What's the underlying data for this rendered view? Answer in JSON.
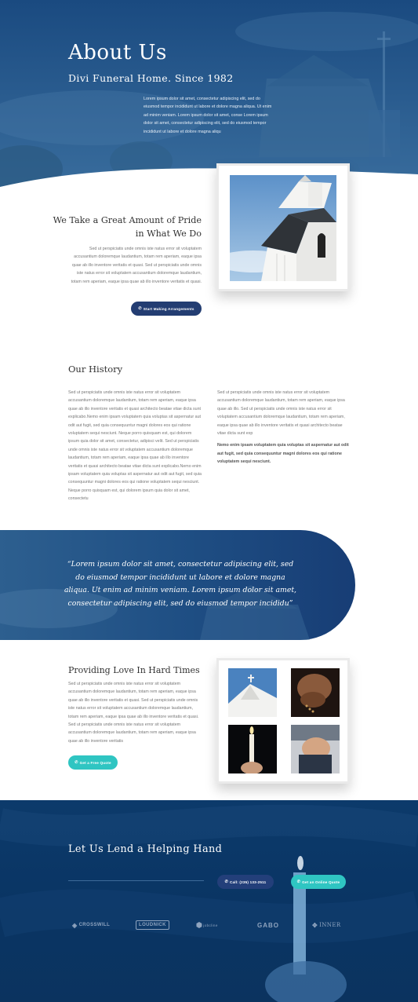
{
  "hero": {
    "title": "About Us",
    "subtitle": "Divi Funeral Home. Since 1982",
    "text": "Lorem ipsum dolor sit amet, consectetur adipiscing elit, sed do eiusmod tempor incididunt ut labore et dolore magna aliqua. Ut enim ad minim veniam. Lorem ipsum dolor sit amet, conse Lorem ipsum dolor sit amet, consectetur adipiscing elit, sed do eiusmod tempor incididunt ut labore et dolore magna aliqu"
  },
  "intro": {
    "title": "We Take a Great Amount of Pride in What We Do",
    "text": "Sed ut perspiciatis unde omnis iste natus error sit voluptatem accusantium doloremque laudantium, totam rem aperiam, eaque ipsa quae ab illo inventore veritatis et quasi. Sed ut perspiciatis unde omnis iste natus error sit voluptatem accusantium doloremque laudantium, totam rem aperiam, eaque ipsa quae ab illo inventore veritatis et quasi.",
    "button_label": "Start Making Arrangements",
    "button_icon": "phone-icon"
  },
  "history": {
    "title": "Our History",
    "left_text": "Sed ut perspiciatis unde omnis iste natus error sit voluptatem accusantium doloremque laudantium, totam rem aperiam, eaque ipsa quae ab illo inventore veritatis et quasi architecto beatae vitae dicta sunt explicabo.Nemo enim ipsam voluptatem quia voluptas sit aspernatur aut odit aut fugit, sed quia consequuntur magni dolores eos qui ratione voluptatem sequi nesciunt. Neque porro quisquam est, qui dolorem ipsum quia dolor sit amet, consectetur, adipisci velit. Sed ut perspiciatis unde omnis iste natus error sit voluptatem accusantium doloremque laudantium, totam rem aperiam, eaque ipsa quae ab illo inventore veritatis et quasi architecto beatae vitae dicta sunt explicabo.Nemo enim ipsam voluptatem quia voluptas sit aspernatur aut odit aut fugit, sed quia consequuntur magni dolores eos qui ratione voluptatem sequi nesciunt. Neque porro quisquam est, qui dolorem ipsum quia dolor sit amet, consectetu",
    "right_text": "Sed ut perspiciatis unde omnis iste natus error sit voluptatem accusantium doloremque laudantium, totam rem aperiam, eaque ipsa quae ab illo. Sed ut perspiciatis unde omnis iste natus error sit voluptatem accusantium doloremque laudantium, totam rem aperiam, eaque ipsa quae ab illo inventore veritatis et quasi architecto beatae vitae dicta sunt exp",
    "right_bold": "Nemo enim ipsam voluptatem quia voluptas sit aspernatur aut odit aut fugit, sed quia consequuntur magni dolores eos qui ratione voluptatem sequi nesciunt."
  },
  "quote": {
    "text": "“Lorem ipsum dolor sit amet, consectetur adipiscing elit, sed do eiusmod tempor incididunt ut labore et dolore magna aliqua. Ut enim ad minim veniam. Lorem ipsum dolor sit amet, consectetur adipiscing elit, sed do eiusmod tempor incididu”"
  },
  "love": {
    "title": "Providing Love In Hard Times",
    "text": "Sed ut perspiciatis unde omnis iste natus error sit voluptatem accusantium doloremque laudantium, totam rem aperiam, eaque ipsa quae ab illo inventore veritatis et quasi. Sed ut perspiciatis unde omnis iste natus error sit voluptatem accusantium doloremque laudantium, totam rem aperiam, eaque ipsa quae ab illo inventore veritatis et quasi. Sed ut perspiciatis unde omnis iste natus error sit voluptatem accusantium doloremque laudantium, totam rem aperiam, eaque ipsa quae ab illo inventore veritatis",
    "button_label": "Get a Free Quote"
  },
  "footer": {
    "title": "Let Us Lend a Helping Hand",
    "call_label": "Call: (235) 133-2511",
    "quote_label": "Get an Online Quote",
    "logos": [
      "CROSSWILL",
      "LOUDNICK",
      "jobcline",
      "GABO",
      "INNER"
    ]
  },
  "colors": {
    "navy": "#233d72",
    "teal": "#2fc5c2",
    "hero_blue": "#1e568d",
    "footer_blue": "#0c3a6b"
  }
}
